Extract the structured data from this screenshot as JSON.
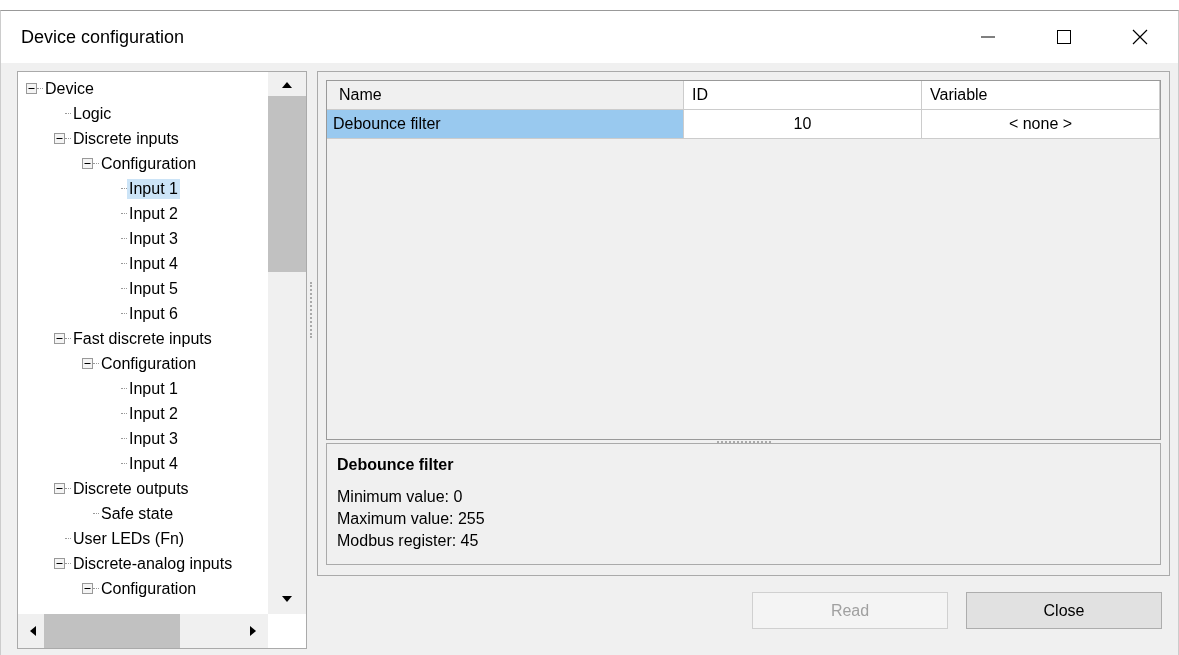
{
  "window": {
    "title": "Device configuration"
  },
  "tree": [
    {
      "label": "Device",
      "expanded": true,
      "selected": false,
      "children": [
        {
          "label": "Logic",
          "selected": false
        },
        {
          "label": "Discrete inputs",
          "expanded": true,
          "selected": false,
          "children": [
            {
              "label": "Configuration",
              "expanded": true,
              "selected": false,
              "children": [
                {
                  "label": "Input 1",
                  "selected": true
                },
                {
                  "label": "Input 2",
                  "selected": false
                },
                {
                  "label": "Input 3",
                  "selected": false
                },
                {
                  "label": "Input 4",
                  "selected": false
                },
                {
                  "label": "Input 5",
                  "selected": false
                },
                {
                  "label": "Input 6",
                  "selected": false
                }
              ]
            }
          ]
        },
        {
          "label": "Fast discrete inputs",
          "expanded": true,
          "selected": false,
          "children": [
            {
              "label": "Configuration",
              "expanded": true,
              "selected": false,
              "children": [
                {
                  "label": "Input 1",
                  "selected": false
                },
                {
                  "label": "Input 2",
                  "selected": false
                },
                {
                  "label": "Input 3",
                  "selected": false
                },
                {
                  "label": "Input 4",
                  "selected": false
                }
              ]
            }
          ]
        },
        {
          "label": "Discrete outputs",
          "expanded": true,
          "selected": false,
          "children": [
            {
              "label": "Safe state",
              "selected": false
            }
          ]
        },
        {
          "label": "User LEDs (Fn)",
          "selected": false
        },
        {
          "label": "Discrete-analog inputs",
          "expanded": true,
          "selected": false,
          "children": [
            {
              "label": "Configuration",
              "expanded": true,
              "selected": false
            }
          ]
        }
      ]
    }
  ],
  "table": {
    "columns": [
      "Name",
      "ID",
      "Variable"
    ],
    "rows": [
      {
        "cells": [
          "Debounce filter",
          "10",
          "< none >"
        ],
        "selected": true
      }
    ]
  },
  "details": {
    "title": "Debounce filter",
    "lines": [
      "Minimum value: 0",
      "Maximum value: 255",
      "Modbus register: 45"
    ]
  },
  "buttons": [
    {
      "label": "Read",
      "disabled": true
    },
    {
      "label": "Close",
      "disabled": false
    }
  ]
}
